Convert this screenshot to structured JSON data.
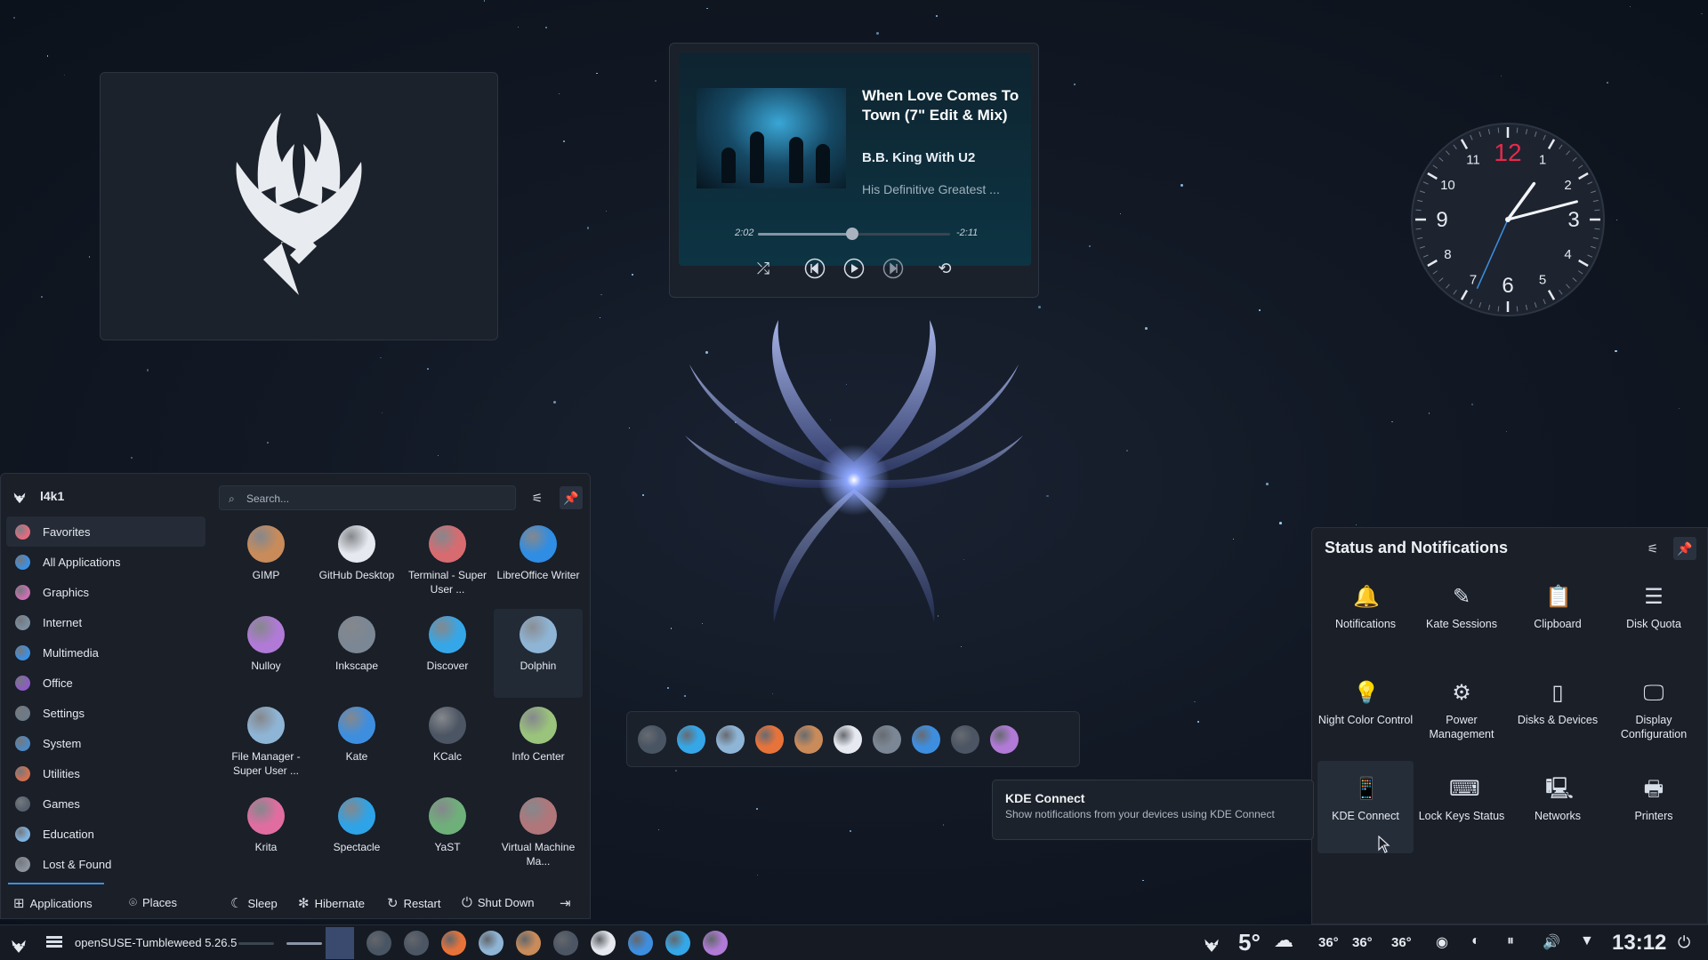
{
  "colors": {
    "accent": "#3d8fe0",
    "panel": "#1a1f28",
    "clock_12": "#e8294a"
  },
  "media_player": {
    "title": "When Love Comes To Town (7\" Edit & Mix)",
    "artist": "B.B. King With U2",
    "album": "His Definitive Greatest ...",
    "elapsed": "2:02",
    "remaining": "-2:11",
    "progress": 0.49,
    "controls": [
      "shuffle-icon",
      "previous-icon",
      "play-icon",
      "next-icon",
      "repeat-icon"
    ]
  },
  "clock": {
    "numerals": [
      "12",
      "1",
      "2",
      "3",
      "4",
      "5",
      "6",
      "7",
      "8",
      "9",
      "10",
      "11"
    ],
    "hour": 1,
    "minute": 12,
    "second": 34
  },
  "launcher": {
    "username": "l4k1",
    "search_placeholder": "Search...",
    "categories": [
      {
        "label": "Favorites",
        "color": "#e36b7f"
      },
      {
        "label": "All Applications",
        "color": "#3d8fe0"
      },
      {
        "label": "Graphics",
        "color": "#c86fb0"
      },
      {
        "label": "Internet",
        "color": "#7a8ea0"
      },
      {
        "label": "Multimedia",
        "color": "#3d8fe0"
      },
      {
        "label": "Office",
        "color": "#8c5cc4"
      },
      {
        "label": "Settings",
        "color": "#6c7a88"
      },
      {
        "label": "System",
        "color": "#4d88c2"
      },
      {
        "label": "Utilities",
        "color": "#d07050"
      },
      {
        "label": "Games",
        "color": "#56606e"
      },
      {
        "label": "Education",
        "color": "#7fb2df"
      },
      {
        "label": "Lost & Found",
        "color": "#8b939e"
      }
    ],
    "apps": [
      {
        "label": "GIMP",
        "color": "#c98b5a"
      },
      {
        "label": "GitHub Desktop",
        "color": "#e6e9ef"
      },
      {
        "label": "Terminal - Super User ...",
        "color": "#d86b70"
      },
      {
        "label": "LibreOffice Writer",
        "color": "#2f8de4"
      },
      {
        "label": "Nulloy",
        "color": "#b07ad6"
      },
      {
        "label": "Inkscape",
        "color": "#7b8794"
      },
      {
        "label": "Discover",
        "color": "#35a7e8"
      },
      {
        "label": "Dolphin",
        "color": "#8fb5d6"
      },
      {
        "label": "File Manager - Super User ...",
        "color": "#8fb5d6"
      },
      {
        "label": "Kate",
        "color": "#3e8ee0"
      },
      {
        "label": "KCalc",
        "color": "#4c5563"
      },
      {
        "label": "Info Center",
        "color": "#9ac37c"
      },
      {
        "label": "Krita",
        "color": "#e16da0"
      },
      {
        "label": "Spectacle",
        "color": "#2ea3e8"
      },
      {
        "label": "YaST",
        "color": "#6fb07a"
      },
      {
        "label": "Virtual Machine Ma...",
        "color": "#b1767a"
      }
    ],
    "footer": {
      "applications": "Applications",
      "places": "Places",
      "sleep": "Sleep",
      "hibernate": "Hibernate",
      "restart": "Restart",
      "shutdown": "Shut Down"
    }
  },
  "dock": {
    "icons": [
      "system-settings-icon",
      "discover-icon",
      "dolphin-icon",
      "firefox-icon",
      "gimp-icon",
      "github-icon",
      "inkscape-icon",
      "kate-icon",
      "kcalc-icon",
      "krita-icon"
    ]
  },
  "status": {
    "title": "Status and Notifications",
    "items": [
      {
        "label": "Notifications",
        "icon": "bell-icon",
        "glyph": "🔔"
      },
      {
        "label": "Kate Sessions",
        "icon": "kate-sessions-icon",
        "glyph": "✎"
      },
      {
        "label": "Clipboard",
        "icon": "clipboard-icon",
        "glyph": "📋"
      },
      {
        "label": "Disk Quota",
        "icon": "disk-quota-icon",
        "glyph": "☰"
      },
      {
        "label": "Night Color Control",
        "icon": "night-color-icon",
        "glyph": "💡"
      },
      {
        "label": "Power Management",
        "icon": "power-management-icon",
        "glyph": "⚙"
      },
      {
        "label": "Disks & Devices",
        "icon": "disks-devices-icon",
        "glyph": "▯"
      },
      {
        "label": "Display Configuration",
        "icon": "display-configuration-icon",
        "glyph": "🖵"
      },
      {
        "label": "KDE Connect",
        "icon": "kde-connect-icon",
        "glyph": "📱"
      },
      {
        "label": "Lock Keys Status",
        "icon": "keyboard-icon",
        "glyph": "⌨"
      },
      {
        "label": "Networks",
        "icon": "networks-icon",
        "glyph": "🖳"
      },
      {
        "label": "Printers",
        "icon": "printer-icon",
        "glyph": "🖶"
      }
    ]
  },
  "tooltip": {
    "title": "KDE Connect",
    "subtitle": "Show notifications from your devices using KDE Connect"
  },
  "taskbar": {
    "window_title": "openSUSE-Tumbleweed 5.26.5",
    "weather_temp": "5°",
    "temps": [
      "36°",
      "36°",
      "36°"
    ],
    "time": "13:12",
    "app_icons": [
      "system-settings-icon",
      "terminal-icon",
      "firefox-icon",
      "dolphin-icon",
      "gimp-icon",
      "kcalc-icon",
      "github-icon",
      "kate-icon",
      "discover-icon",
      "krita-icon"
    ]
  }
}
